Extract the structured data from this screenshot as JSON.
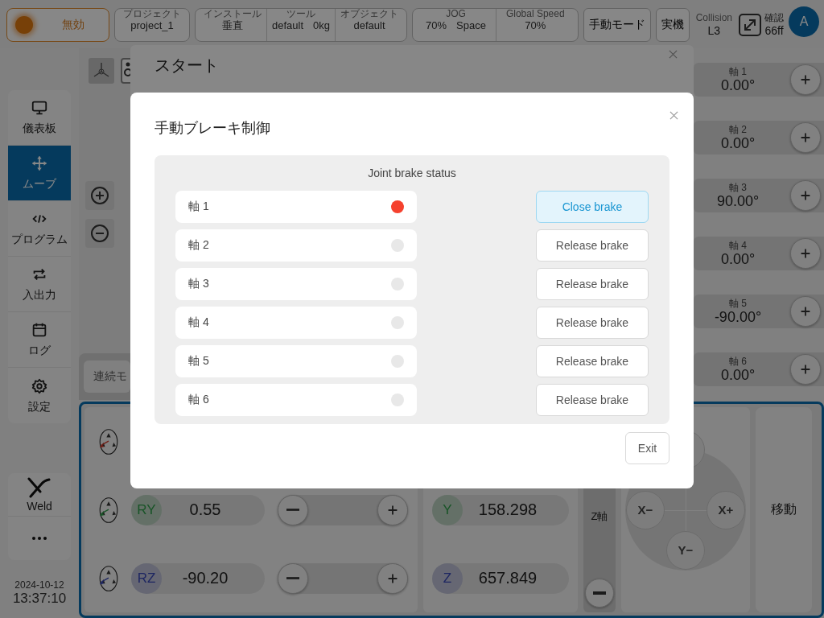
{
  "top_bar": {
    "power": {
      "label": "無効"
    },
    "project": {
      "label": "プロジェクト",
      "values": [
        "project_1"
      ]
    },
    "setup": [
      {
        "label": "インストール",
        "values": [
          "垂直"
        ]
      },
      {
        "label": "ツール",
        "values": [
          "default",
          "0kg"
        ]
      },
      {
        "label": "オブジェクト",
        "values": [
          "default"
        ]
      }
    ],
    "speed": [
      {
        "label": "JOG",
        "values": [
          "70%",
          "Space"
        ]
      },
      {
        "label": "Global Speed",
        "values": [
          "70%"
        ]
      }
    ],
    "mode_buttons": [
      "手動モード",
      "実機"
    ],
    "collision": {
      "label": "Collision",
      "value": "L3"
    },
    "confirm": {
      "label": "確認",
      "value": "66ff"
    },
    "avatar": "A"
  },
  "sidebar": {
    "items": [
      {
        "label": "儀表板",
        "kind": "monitor",
        "selected": false
      },
      {
        "label": "ムーブ",
        "kind": "move",
        "selected": true
      },
      {
        "label": "プログラム",
        "kind": "code",
        "selected": false
      },
      {
        "label": "入出力",
        "kind": "swap",
        "selected": false
      },
      {
        "label": "ログ",
        "kind": "calendar",
        "selected": false
      },
      {
        "label": "設定",
        "kind": "gear",
        "selected": false
      }
    ],
    "tools": [
      {
        "label": "Weld",
        "kind": "weld"
      },
      {
        "kind": "more"
      }
    ],
    "date": "2024-10-12",
    "time": "13:37:10"
  },
  "canvas": {
    "mode_button": "連続モ"
  },
  "joints": [
    {
      "name": "軸 1",
      "value": "0.00°"
    },
    {
      "name": "軸 2",
      "value": "0.00°"
    },
    {
      "name": "軸 3",
      "value": "90.00°"
    },
    {
      "name": "軸 4",
      "value": "0.00°"
    },
    {
      "name": "軸 5",
      "value": "-90.00°"
    },
    {
      "name": "軸 6",
      "value": "0.00°"
    }
  ],
  "rotation_rows": [
    {
      "kind": "x"
    },
    {
      "kind": "y",
      "label": "RY",
      "value": "0.55"
    },
    {
      "kind": "z",
      "label": "RZ",
      "value": "-90.20"
    }
  ],
  "translation_rows": [
    {
      "kind": "y",
      "label": "Y",
      "value": "158.298"
    },
    {
      "kind": "z",
      "label": "Z",
      "value": "657.849"
    }
  ],
  "z_axis": {
    "label": "Z軸"
  },
  "jog_pad": [
    "X−",
    "X+",
    "Y−"
  ],
  "move_button": "移動",
  "back_dialog": {
    "title": "スタート"
  },
  "brake_dialog": {
    "title": "手動ブレーキ制御",
    "section_title": "Joint brake status",
    "joints": [
      {
        "name": "軸 1",
        "released": true,
        "action": "Close brake"
      },
      {
        "name": "軸 2",
        "released": false,
        "action": "Release brake"
      },
      {
        "name": "軸 3",
        "released": false,
        "action": "Release brake"
      },
      {
        "name": "軸 4",
        "released": false,
        "action": "Release brake"
      },
      {
        "name": "軸 5",
        "released": false,
        "action": "Release brake"
      },
      {
        "name": "軸 6",
        "released": false,
        "action": "Release brake"
      }
    ],
    "exit": "Exit"
  }
}
